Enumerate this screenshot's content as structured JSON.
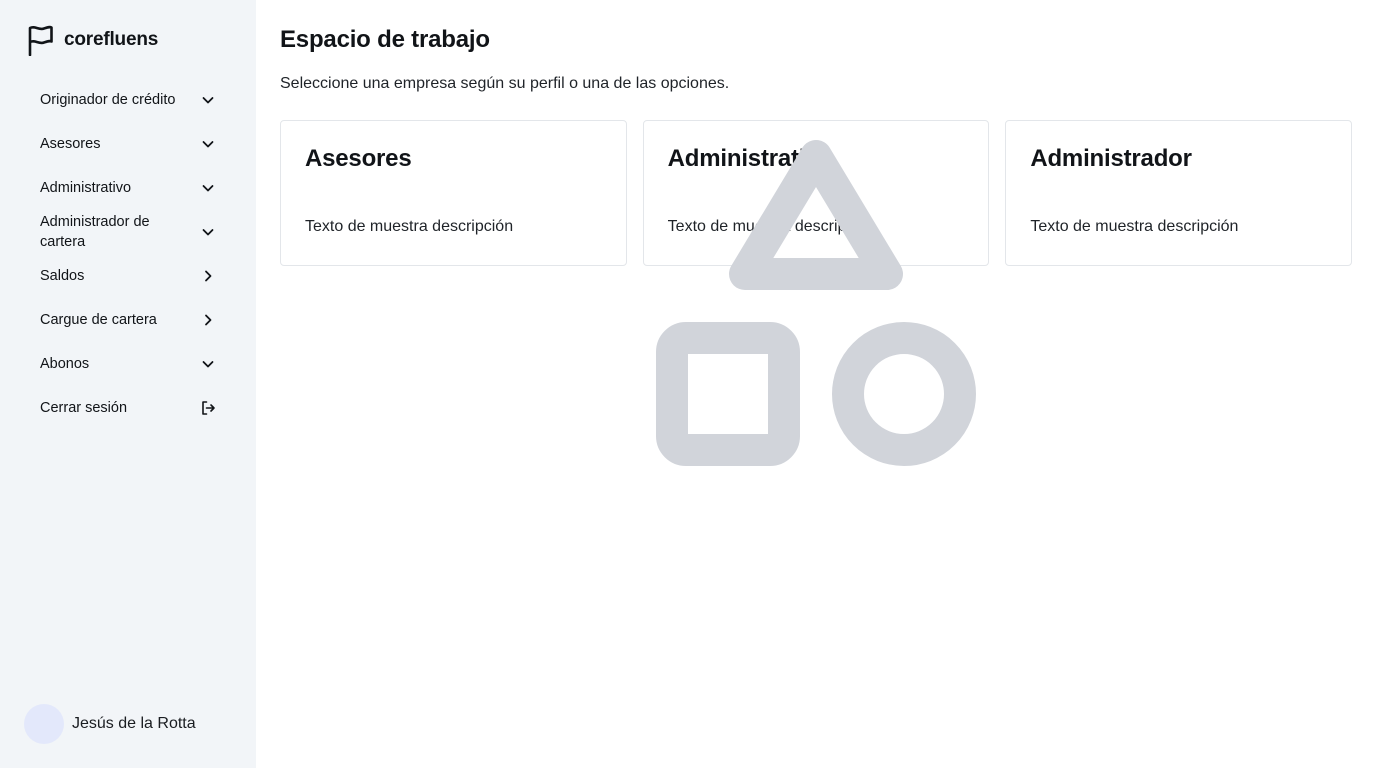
{
  "app": {
    "brand": "corefluens"
  },
  "sidebar": {
    "items": [
      {
        "label": "Originador de crédito",
        "icon": "chevron-down-icon"
      },
      {
        "label": "Asesores",
        "icon": "chevron-down-icon"
      },
      {
        "label": "Administrativo",
        "icon": "chevron-down-icon"
      },
      {
        "label": "Administrador de cartera",
        "icon": "chevron-down-icon"
      },
      {
        "label": "Saldos",
        "icon": "chevron-right-icon"
      },
      {
        "label": "Cargue de cartera",
        "icon": "chevron-right-icon"
      },
      {
        "label": "Abonos",
        "icon": "chevron-down-icon"
      },
      {
        "label": "Cerrar sesión",
        "icon": "logout-icon"
      }
    ],
    "user": {
      "name": "Jesús de la Rotta"
    }
  },
  "main": {
    "title": "Espacio de trabajo",
    "subtitle": "Seleccione una empresa según su perfil o una de las opciones.",
    "cards": [
      {
        "title": "Asesores",
        "description": "Texto de muestra descripción"
      },
      {
        "title": "Administrativo",
        "description": "Texto de muestra descripción"
      },
      {
        "title": "Administrador",
        "description": "Texto de muestra descripción"
      }
    ]
  },
  "colors": {
    "sidebar_bg": "#f2f5f8",
    "avatar_bg": "#e3e8fb",
    "placeholder_shapes": "#d1d4da",
    "card_border": "#e3e6ea"
  }
}
